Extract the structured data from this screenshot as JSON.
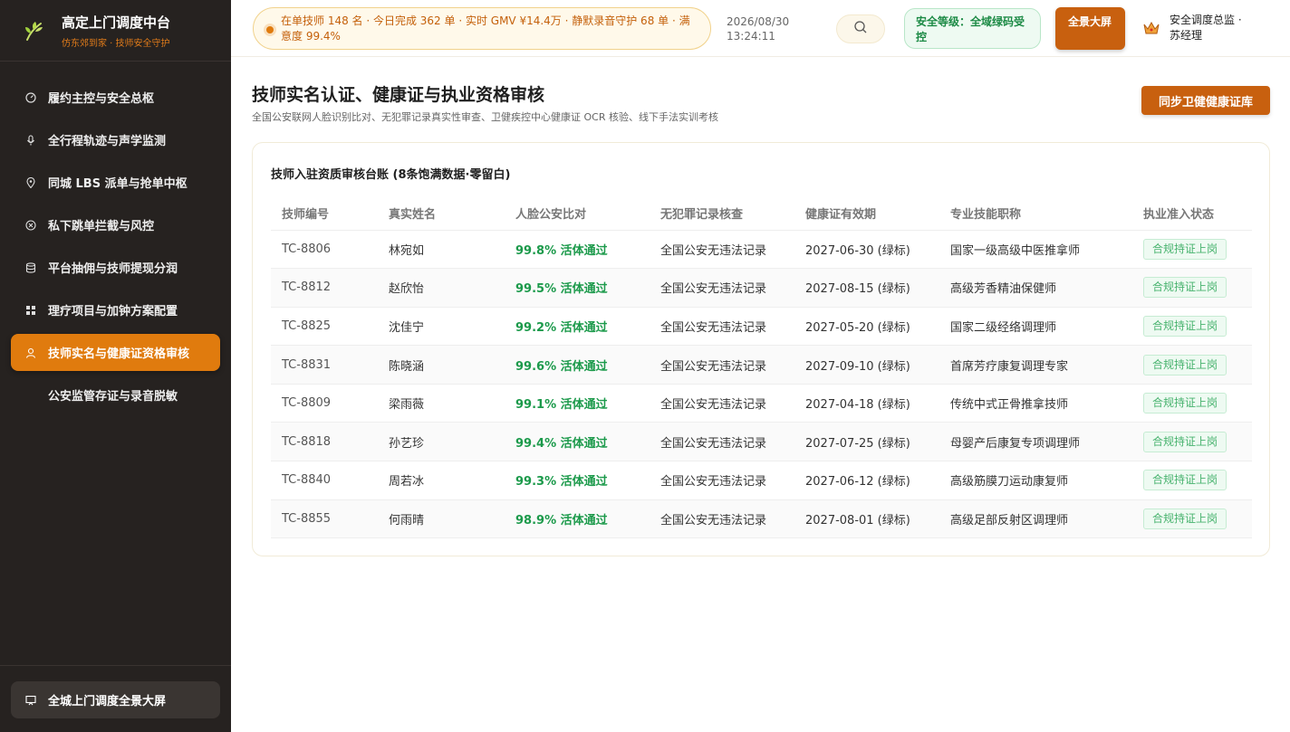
{
  "brand": {
    "title": "高定上门调度中台",
    "subtitle": "仿东郊到家 · 技师安全守护",
    "logo_icon": "leaf-icon"
  },
  "sidebar": {
    "items": [
      {
        "label": "履约主控与安全总枢",
        "icon": "gauge-icon",
        "active": false
      },
      {
        "label": "全行程轨迹与声学监测",
        "icon": "microphone-icon",
        "active": false
      },
      {
        "label": "同城 LBS 派单与抢单中枢",
        "icon": "map-pin-icon",
        "active": false
      },
      {
        "label": "私下跳单拦截与风控",
        "icon": "block-icon",
        "active": false
      },
      {
        "label": "平台抽佣与技师提现分润",
        "icon": "database-icon",
        "active": false
      },
      {
        "label": "理疗项目与加钟方案配置",
        "icon": "grid-icon",
        "active": false
      },
      {
        "label": "技师实名与健康证资格审核",
        "icon": "user-icon",
        "active": true
      },
      {
        "label": "公安监管存证与录音脱敏",
        "icon": "",
        "active": false
      }
    ],
    "bottom_button": {
      "label": "全城上门调度全景大屏",
      "icon": "monitor-icon"
    }
  },
  "topbar": {
    "ticker": "在单技师 148 名 · 今日完成 362 单 · 实时 GMV ¥14.4万 · 静默录音守护 68 单 · 满意度 99.4%",
    "date": "2026/08/30",
    "time": "13:24:11",
    "search_icon": "search-icon",
    "security": "安全等级：全域绿码受控",
    "fullscreen_label": "全景大屏",
    "user_name": "安全调度总监 · 苏经理",
    "user_icon": "crown-icon"
  },
  "page": {
    "title": "技师实名认证、健康证与执业资格审核",
    "subtitle": "全国公安联网人脸识别比对、无犯罪记录真实性审查、卫健疾控中心健康证 OCR 核验、线下手法实训考核",
    "sync_button": "同步卫健健康证库"
  },
  "card": {
    "title": "技师入驻资质审核台账 (8条饱满数据·零留白)"
  },
  "table": {
    "headers": [
      "技师编号",
      "真实姓名",
      "人脸公安比对",
      "无犯罪记录核查",
      "健康证有效期",
      "专业技能职称",
      "执业准入状态"
    ],
    "rows": [
      {
        "id": "TC-8806",
        "name": "林宛如",
        "face": "99.8% 活体通过",
        "record": "全国公安无违法记录",
        "health": "2027-06-30 (绿标)",
        "title": "国家一级高级中医推拿师",
        "status": "合规持证上岗"
      },
      {
        "id": "TC-8812",
        "name": "赵欣怡",
        "face": "99.5% 活体通过",
        "record": "全国公安无违法记录",
        "health": "2027-08-15 (绿标)",
        "title": "高级芳香精油保健师",
        "status": "合规持证上岗"
      },
      {
        "id": "TC-8825",
        "name": "沈佳宁",
        "face": "99.2% 活体通过",
        "record": "全国公安无违法记录",
        "health": "2027-05-20 (绿标)",
        "title": "国家二级经络调理师",
        "status": "合规持证上岗"
      },
      {
        "id": "TC-8831",
        "name": "陈晓涵",
        "face": "99.6% 活体通过",
        "record": "全国公安无违法记录",
        "health": "2027-09-10 (绿标)",
        "title": "首席芳疗康复调理专家",
        "status": "合规持证上岗"
      },
      {
        "id": "TC-8809",
        "name": "梁雨薇",
        "face": "99.1% 活体通过",
        "record": "全国公安无违法记录",
        "health": "2027-04-18 (绿标)",
        "title": "传统中式正骨推拿技师",
        "status": "合规持证上岗"
      },
      {
        "id": "TC-8818",
        "name": "孙艺珍",
        "face": "99.4% 活体通过",
        "record": "全国公安无违法记录",
        "health": "2027-07-25 (绿标)",
        "title": "母婴产后康复专项调理师",
        "status": "合规持证上岗"
      },
      {
        "id": "TC-8840",
        "name": "周若冰",
        "face": "99.3% 活体通过",
        "record": "全国公安无违法记录",
        "health": "2027-06-12 (绿标)",
        "title": "高级筋膜刀运动康复师",
        "status": "合规持证上岗"
      },
      {
        "id": "TC-8855",
        "name": "何雨晴",
        "face": "98.9% 活体通过",
        "record": "全国公安无违法记录",
        "health": "2027-08-01 (绿标)",
        "title": "高级足部反射区调理师",
        "status": "合规持证上岗"
      }
    ]
  },
  "colors": {
    "accent": "#e07b0e",
    "sidebar_bg": "#262220",
    "success": "#1c9a4b"
  }
}
